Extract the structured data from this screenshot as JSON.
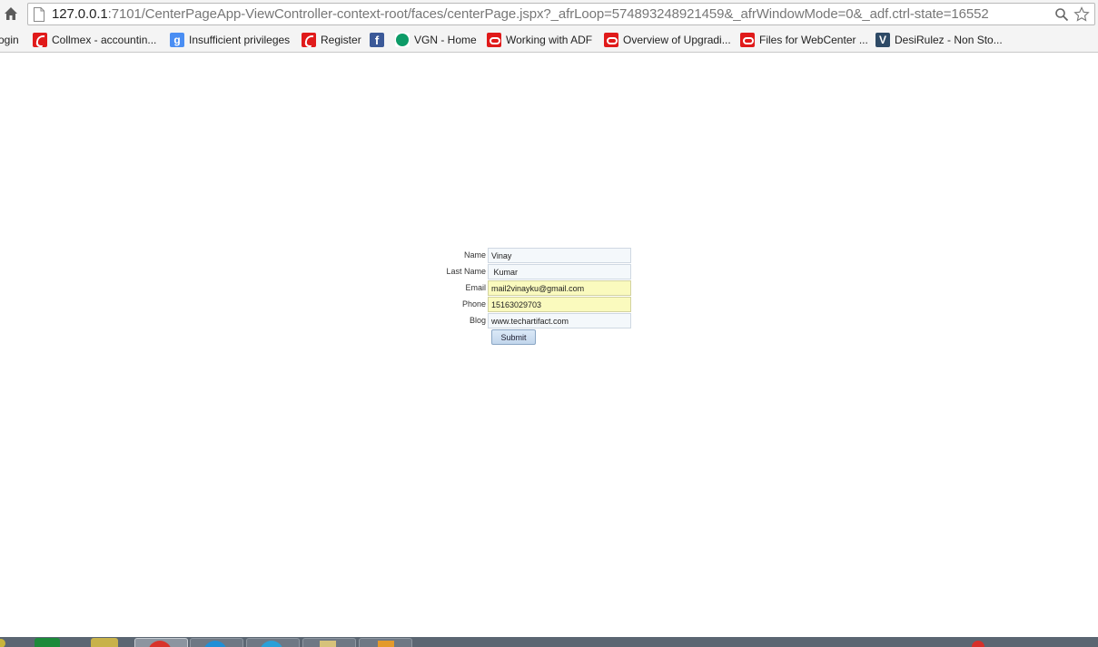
{
  "address_bar": {
    "url_host": "127.0.0.1",
    "url_rest": ":7101/CenterPageApp-ViewController-context-root/faces/centerPage.jspx?_afrLoop=574893248921459&_afrWindowMode=0&_adf.ctrl-state=16552"
  },
  "bookmarks": [
    {
      "label": "ogin",
      "icon": "none"
    },
    {
      "label": "Collmex - accountin...",
      "icon": "red-e-icon"
    },
    {
      "label": "Insufficient privileges",
      "icon": "google-icon"
    },
    {
      "label": "Register",
      "icon": "red-e-icon"
    },
    {
      "label": "",
      "icon": "facebook-icon"
    },
    {
      "label": "VGN - Home",
      "icon": "vgn-icon"
    },
    {
      "label": "Working with ADF",
      "icon": "oracle-icon"
    },
    {
      "label": "Overview of Upgradi...",
      "icon": "oracle-icon"
    },
    {
      "label": "Files for WebCenter ...",
      "icon": "oracle-icon"
    },
    {
      "label": "DesiRulez - Non Sto...",
      "icon": "desirulez-icon"
    }
  ],
  "form": {
    "name_label": "Name",
    "name_value": "Vinay",
    "lastname_label": "Last Name",
    "lastname_value": " Kumar",
    "email_label": "Email",
    "email_value": "mail2vinayku@gmail.com",
    "phone_label": "Phone",
    "phone_value": "15163029703",
    "blog_label": "Blog",
    "blog_value": "www.techartifact.com",
    "submit_label": "Submit"
  },
  "colors": {
    "autofill_yellow": "#fafabe",
    "input_blue": "#f4f8fb",
    "button_blue": "#c8dbef"
  }
}
